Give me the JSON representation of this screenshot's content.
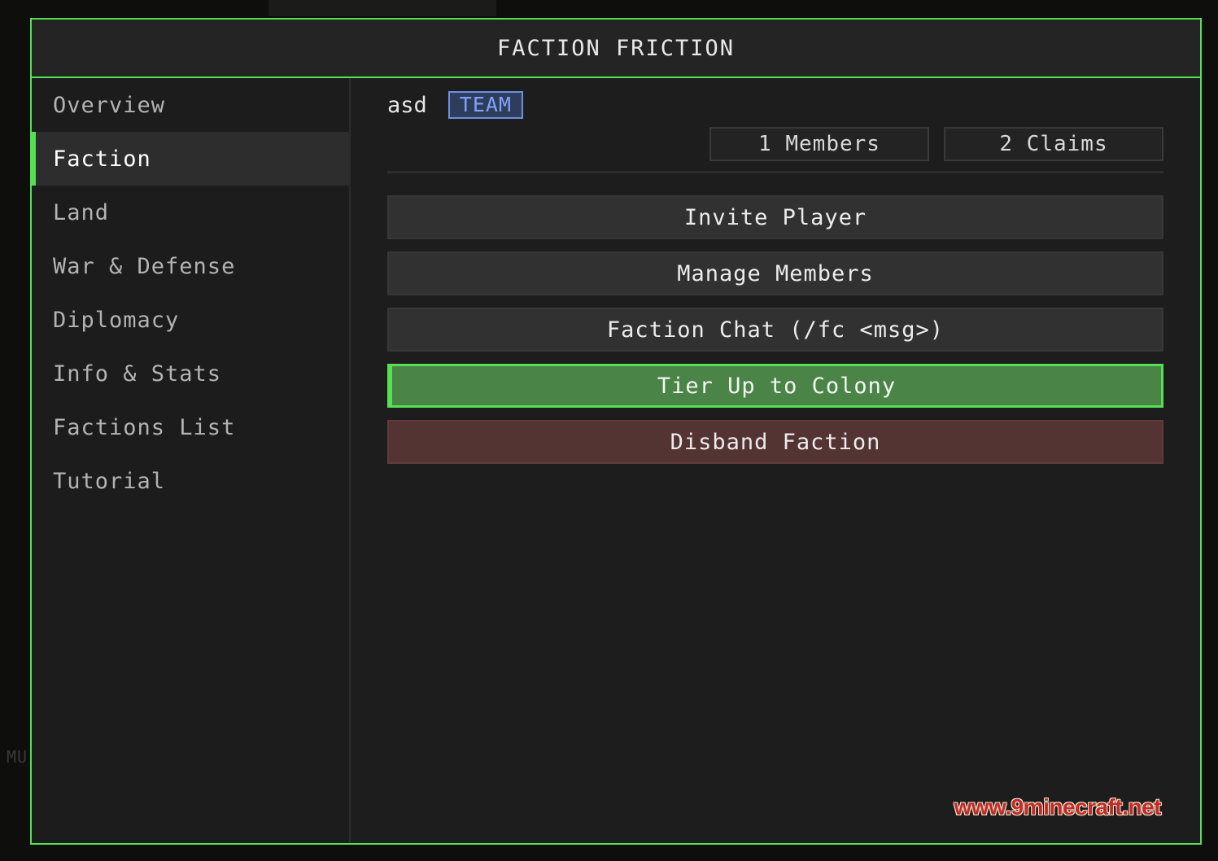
{
  "background": {
    "left_text": "MU"
  },
  "window": {
    "title": "FACTION FRICTION"
  },
  "sidebar": {
    "items": [
      {
        "label": "Overview",
        "active": false
      },
      {
        "label": "Faction",
        "active": true
      },
      {
        "label": "Land",
        "active": false
      },
      {
        "label": "War & Defense",
        "active": false
      },
      {
        "label": "Diplomacy",
        "active": false
      },
      {
        "label": "Info & Stats",
        "active": false
      },
      {
        "label": "Factions List",
        "active": false
      },
      {
        "label": "Tutorial",
        "active": false
      }
    ]
  },
  "faction": {
    "name": "asd",
    "badge": "TEAM",
    "members": "1 Members",
    "claims": "2 Claims"
  },
  "actions": {
    "invite": "Invite Player",
    "manage": "Manage Members",
    "chat": "Faction Chat (/fc <msg>)",
    "tier_up": "Tier Up to Colony",
    "disband": "Disband Faction"
  },
  "watermark": "www.9minecraft.net",
  "colors": {
    "accent": "#55e055",
    "badge": "#7fa3f5",
    "primary_button": "#4a8547",
    "danger_button": "#533433",
    "watermark": "#c22a2a"
  }
}
